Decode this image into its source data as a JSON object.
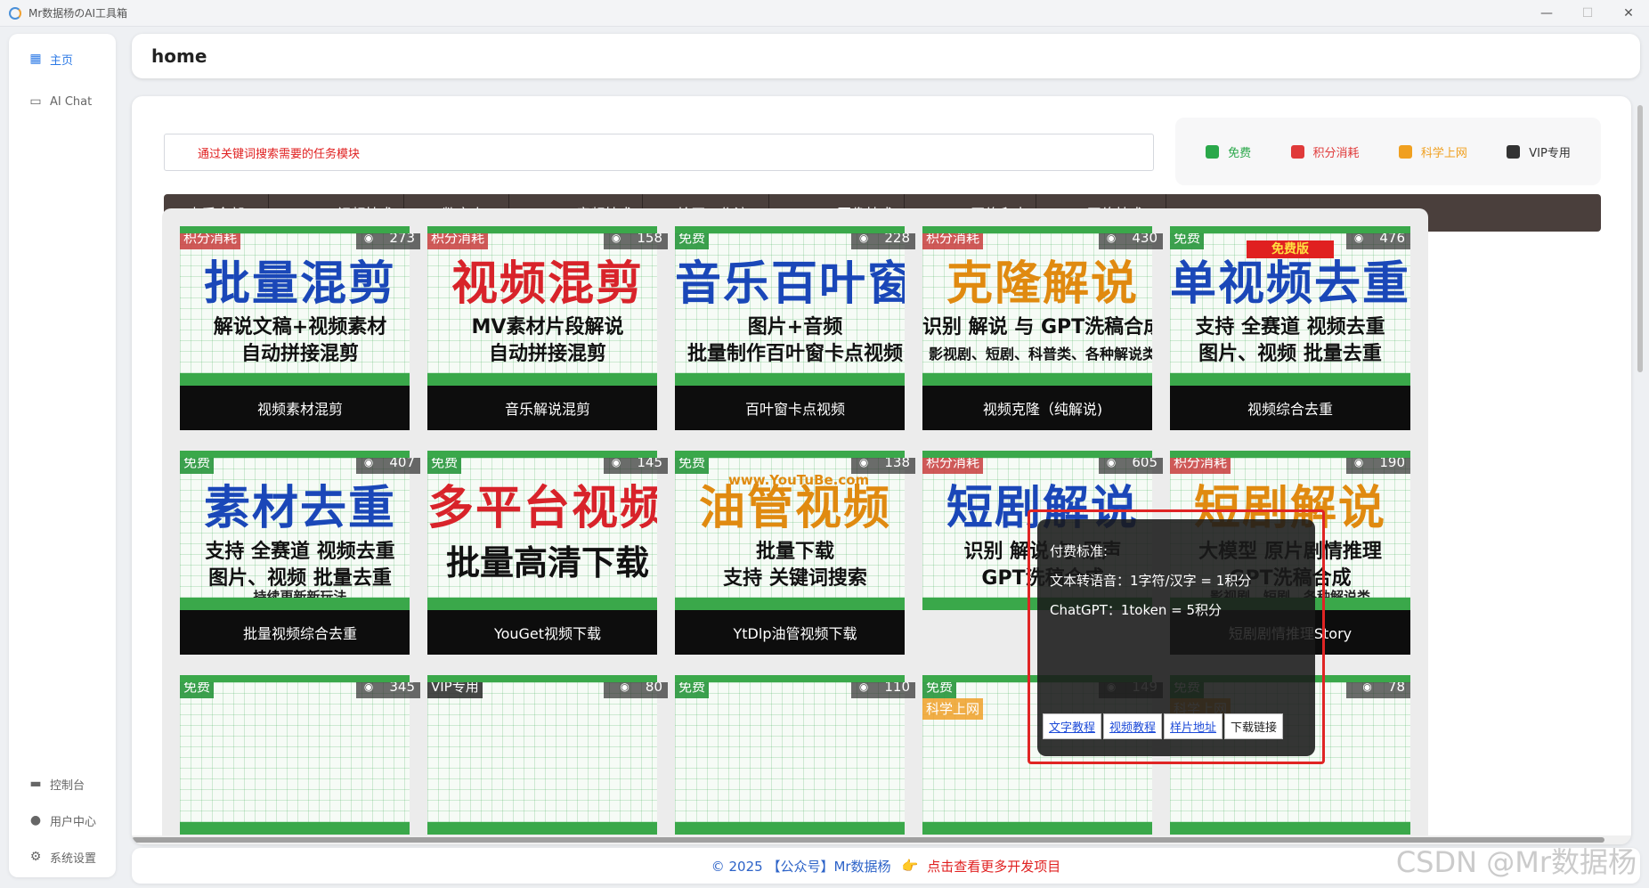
{
  "window": {
    "title": "Mr数据杨のAI工具箱",
    "controls": [
      "—",
      "☐",
      "✕"
    ]
  },
  "sidebar": {
    "items": [
      {
        "icon": "grid-icon",
        "label": "主页",
        "active": true
      },
      {
        "icon": "chat-icon",
        "label": "AI Chat",
        "active": false
      }
    ],
    "bottom_items": [
      {
        "icon": "monitor-icon",
        "label": "控制台"
      },
      {
        "icon": "user-icon",
        "label": "用户中心"
      },
      {
        "icon": "gear-icon",
        "label": "系统设置"
      }
    ]
  },
  "header": {
    "title": "home"
  },
  "search": {
    "placeholder": "通过关键词搜索需要的任务模块"
  },
  "legend": [
    {
      "label": "免费",
      "color": "#2aa84a"
    },
    {
      "label": "积分消耗",
      "color": "#e03a3a"
    },
    {
      "label": "科学上网",
      "color": "#f0a020"
    },
    {
      "label": "VIP专用",
      "color": "#333333"
    }
  ],
  "categories": [
    "查看全部",
    "PYTHON视频技术",
    "AI数字人",
    "PYTHON音频技术",
    "AI绘画工作流",
    "PYTHON图像技术",
    "PYTHON网络爬虫",
    "SEO网络技术"
  ],
  "cards": [
    {
      "badge": "积分消耗",
      "views": "273",
      "line1": "批量混剪",
      "line1_color": "#1a47b8",
      "line2": "解说文稿+视频素材",
      "line3": "自动拼接混剪",
      "caption": "视频素材混剪"
    },
    {
      "badge": "积分消耗",
      "views": "158",
      "line1": "视频混剪",
      "line1_color": "#d8232a",
      "line2": "MV素材片段解说",
      "line3": "自动拼接混剪",
      "caption": "音乐解说混剪"
    },
    {
      "badge": "免费",
      "views": "228",
      "line1": "音乐百叶窗",
      "line1_color": "#1a47b8",
      "line2": "图片+音频",
      "line3": "批量制作百叶窗卡点视频",
      "caption": "百叶窗卡点视频"
    },
    {
      "badge": "积分消耗",
      "views": "430",
      "line1": "克隆解说",
      "line1_color": "#e08a10",
      "line2": "识别 解说 与 GPT洗稿合成",
      "line3": "影视剧、短剧、科普类、各种解说类",
      "caption": "视频克隆（纯解说)"
    },
    {
      "badge": "免费",
      "views": "476",
      "line1": "单视频去重",
      "line1_color": "#1a47b8",
      "line2": "支持 全赛道 视频去重",
      "line3": "图片、视频 批量去重",
      "caption": "视频综合去重",
      "ribbon": "免费版"
    },
    {
      "badge": "免费",
      "views": "407",
      "line1": "素材去重",
      "line1_color": "#1a47b8",
      "line2": "支持 全赛道 视频去重",
      "line3": "图片、视频 批量去重",
      "line4": "持续更新新玩法",
      "caption": "批量视频综合去重"
    },
    {
      "badge": "免费",
      "views": "145",
      "line1": "多平台视频",
      "line1_color": "#d8232a",
      "line2": "批量高清下载",
      "line3": "",
      "caption": "YouGet视频下载"
    },
    {
      "badge": "免费",
      "views": "138",
      "line1": "油管视频",
      "line1_color": "#e08a10",
      "line2": "批量下载",
      "line3": "支持 关键词搜索",
      "caption": "YtDlp油管视频下载",
      "topline": "www.YouTuBe.com"
    },
    {
      "badge": "积分消耗",
      "views": "605",
      "line1": "短剧解说",
      "line1_color": "#1a47b8",
      "line2": "识别 解说 与 原声",
      "line3": "GPT洗稿合成",
      "caption": ""
    },
    {
      "badge": "积分消耗",
      "views": "190",
      "line1": "短剧解说",
      "line1_color": "#e08a10",
      "line2": "大模型 原片剧情推理",
      "line3": "GPT洗稿合成",
      "line4": "影视剧、短剧、各种解说类",
      "caption": "短剧剧情推理Story"
    },
    {
      "badge": "免费",
      "views": "345",
      "line1": "",
      "line1_color": "#e08a10",
      "caption": ""
    },
    {
      "badge": "VIP专用",
      "views": "80",
      "line1": "",
      "line1_color": "#d8232a",
      "caption": ""
    },
    {
      "badge": "免费",
      "views": "110",
      "line1": "",
      "line1_color": "#e08a10",
      "caption": ""
    },
    {
      "badge": "免费",
      "badge2": "科学上网",
      "views": "149",
      "line1": "",
      "caption": ""
    },
    {
      "badge": "免费",
      "badge2": "科学上网",
      "views": "78",
      "line1": "",
      "caption": ""
    }
  ],
  "popup": {
    "lines": [
      "付费标准:",
      "文本转语音：1字符/汉字 = 1积分",
      "ChatGPT：1token = 5积分"
    ],
    "links": [
      "文字教程",
      "视频教程",
      "样片地址",
      "下载链接"
    ]
  },
  "footer": {
    "copyright": "© 2025 【公众号】Mr数据杨",
    "cta": "点击查看更多开发项目"
  },
  "watermark": "CSDN @Mr数据杨"
}
